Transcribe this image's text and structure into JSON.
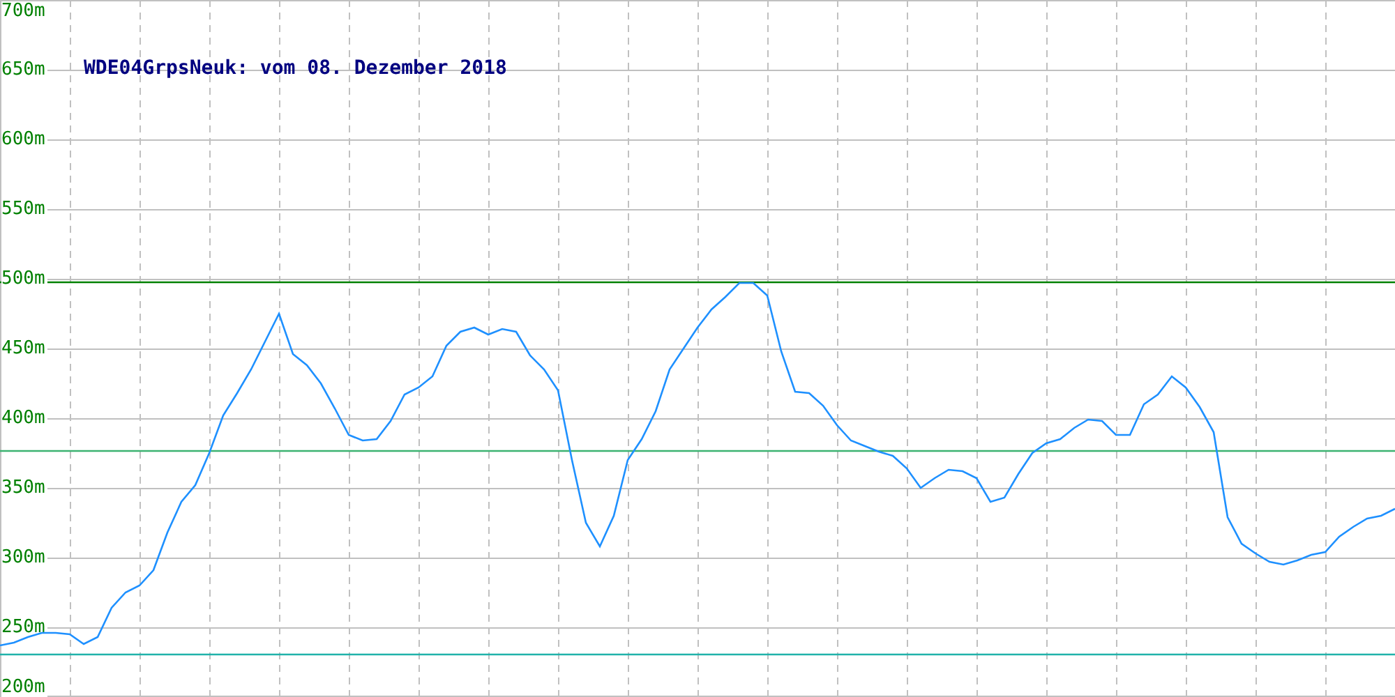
{
  "chart_data": {
    "type": "line",
    "title": "WDE04GrpsNeuk: vom 08. Dezember 2018",
    "ylim": [
      200,
      700
    ],
    "yticks": [
      {
        "value": 200,
        "label": "200m"
      },
      {
        "value": 250,
        "label": "250m"
      },
      {
        "value": 300,
        "label": "300m"
      },
      {
        "value": 350,
        "label": "350m"
      },
      {
        "value": 400,
        "label": "400m"
      },
      {
        "value": 450,
        "label": "450m"
      },
      {
        "value": 500,
        "label": "500m"
      },
      {
        "value": 550,
        "label": "550m"
      },
      {
        "value": 600,
        "label": "600m"
      },
      {
        "value": 650,
        "label": "650m"
      },
      {
        "value": 700,
        "label": "700m"
      }
    ],
    "categories": [
      null,
      null,
      null,
      null,
      null,
      null,
      null,
      null,
      null,
      null,
      null,
      null,
      null,
      null,
      null,
      null,
      null,
      null,
      null,
      null,
      null,
      null,
      null,
      null,
      null,
      null,
      null,
      null,
      null,
      null,
      null,
      null,
      null,
      null,
      null,
      null,
      null,
      null,
      null,
      null,
      null,
      null,
      null,
      null,
      null,
      null,
      null,
      null,
      null,
      null,
      null,
      null,
      null,
      null,
      null,
      null,
      null,
      null,
      null,
      null,
      null,
      null,
      null,
      null,
      null,
      null,
      null,
      null,
      null,
      null,
      null,
      null,
      null,
      null,
      null,
      null,
      null,
      null,
      null,
      null,
      null,
      null,
      null,
      null,
      null,
      null,
      null,
      null,
      null,
      null,
      null,
      null,
      null,
      null,
      null,
      null,
      null,
      null,
      null,
      null,
      null
    ],
    "series": [
      {
        "color": "#1e90ff",
        "values": [
          237,
          239,
          243,
          246,
          246,
          245,
          238,
          243,
          264,
          275,
          280,
          291,
          318,
          340,
          352,
          375,
          402,
          418,
          435,
          455,
          475,
          446,
          438,
          425,
          407,
          388,
          384,
          385,
          398,
          417,
          422,
          430,
          452,
          462,
          465,
          460,
          464,
          462,
          445,
          435,
          420,
          370,
          325,
          308,
          330,
          370,
          385,
          405,
          435,
          450,
          465,
          478,
          487,
          497,
          497,
          488,
          448,
          419,
          418,
          409,
          395,
          384,
          380,
          376,
          373,
          364,
          350,
          357,
          363,
          362,
          357,
          340,
          343,
          360,
          375,
          382,
          385,
          393,
          399,
          398,
          388,
          388,
          410,
          417,
          430,
          422,
          408,
          390,
          329,
          310,
          303,
          297,
          295,
          298,
          302,
          304,
          315,
          322,
          328,
          330,
          335
        ]
      }
    ],
    "grid": true,
    "ref_lines": [
      {
        "axis": "y",
        "value": 498,
        "color": "#008000"
      },
      {
        "axis": "y",
        "value": 377,
        "color": "#3cb371"
      },
      {
        "axis": "y",
        "value": 231,
        "color": "#20b2aa"
      }
    ]
  }
}
